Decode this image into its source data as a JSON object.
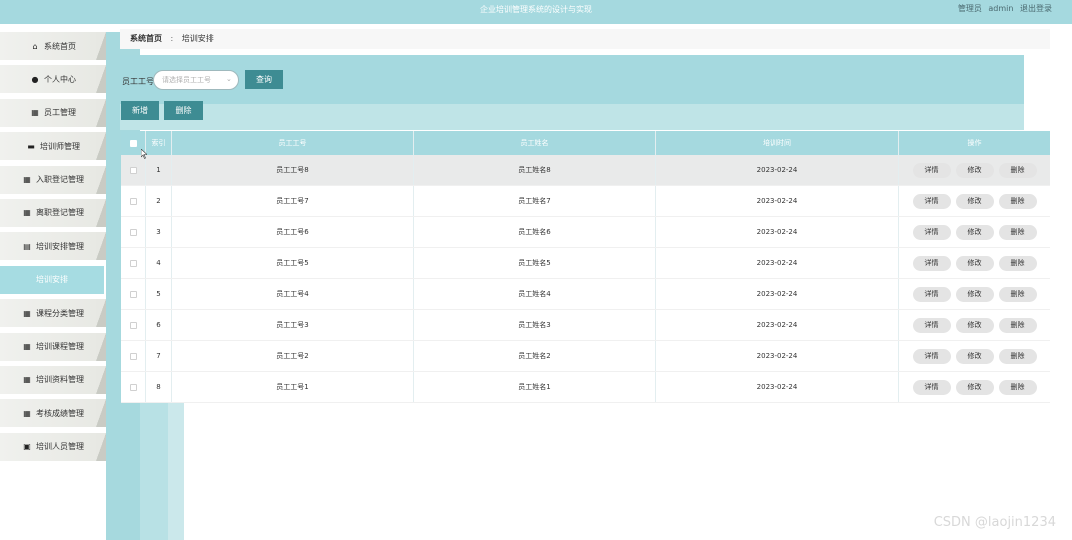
{
  "header": {
    "title": "企业培训管理系统的设计与实现",
    "role": "管理员",
    "username": "admin",
    "logout": "退出登录"
  },
  "sidebar": {
    "items": [
      {
        "label": "系统首页",
        "icon": "home-icon",
        "glyph": "⌂"
      },
      {
        "label": "个人中心",
        "icon": "user-icon",
        "glyph": "●"
      },
      {
        "label": "员工管理",
        "icon": "grid-icon",
        "glyph": "▦"
      },
      {
        "label": "培训师管理",
        "icon": "lock-icon",
        "glyph": "▬"
      },
      {
        "label": "入职登记管理",
        "icon": "grid-icon",
        "glyph": "▦"
      },
      {
        "label": "离职登记管理",
        "icon": "grid-icon",
        "glyph": "▦"
      },
      {
        "label": "培训安排管理",
        "icon": "doc-icon",
        "glyph": "▤"
      },
      {
        "label": "培训安排",
        "icon": "",
        "glyph": ""
      },
      {
        "label": "课程分类管理",
        "icon": "grid-icon",
        "glyph": "▦"
      },
      {
        "label": "培训课程管理",
        "icon": "grid-icon",
        "glyph": "▦"
      },
      {
        "label": "培训资料管理",
        "icon": "grid-icon",
        "glyph": "▦"
      },
      {
        "label": "考核成绩管理",
        "icon": "grid-icon",
        "glyph": "▦"
      },
      {
        "label": "培训人员管理",
        "icon": "check-icon",
        "glyph": "▣"
      }
    ],
    "active_index": 7
  },
  "breadcrumb": {
    "home": "系统首页",
    "separator": ":",
    "current": "培训安排"
  },
  "search": {
    "label": "员工工号",
    "placeholder": "请选择员工工号",
    "query_button": "查询"
  },
  "actions": {
    "add": "新增",
    "delete": "删除"
  },
  "table": {
    "headers": {
      "index": "索引",
      "emp_no": "员工工号",
      "emp_name": "员工姓名",
      "date": "培训时间",
      "ops": "操作"
    },
    "op_labels": {
      "detail": "详情",
      "edit": "修改",
      "delete": "删除"
    },
    "rows": [
      {
        "index": "1",
        "emp_no": "员工工号8",
        "emp_name": "员工姓名8",
        "date": "2023-02-24"
      },
      {
        "index": "2",
        "emp_no": "员工工号7",
        "emp_name": "员工姓名7",
        "date": "2023-02-24"
      },
      {
        "index": "3",
        "emp_no": "员工工号6",
        "emp_name": "员工姓名6",
        "date": "2023-02-24"
      },
      {
        "index": "4",
        "emp_no": "员工工号5",
        "emp_name": "员工姓名5",
        "date": "2023-02-24"
      },
      {
        "index": "5",
        "emp_no": "员工工号4",
        "emp_name": "员工姓名4",
        "date": "2023-02-24"
      },
      {
        "index": "6",
        "emp_no": "员工工号3",
        "emp_name": "员工姓名3",
        "date": "2023-02-24"
      },
      {
        "index": "7",
        "emp_no": "员工工号2",
        "emp_name": "员工姓名2",
        "date": "2023-02-24"
      },
      {
        "index": "8",
        "emp_no": "员工工号1",
        "emp_name": "员工姓名1",
        "date": "2023-02-24"
      }
    ]
  },
  "watermark": "CSDN @laojin1234",
  "colors": {
    "accent": "#a5d9df",
    "button": "#3e8c93"
  }
}
